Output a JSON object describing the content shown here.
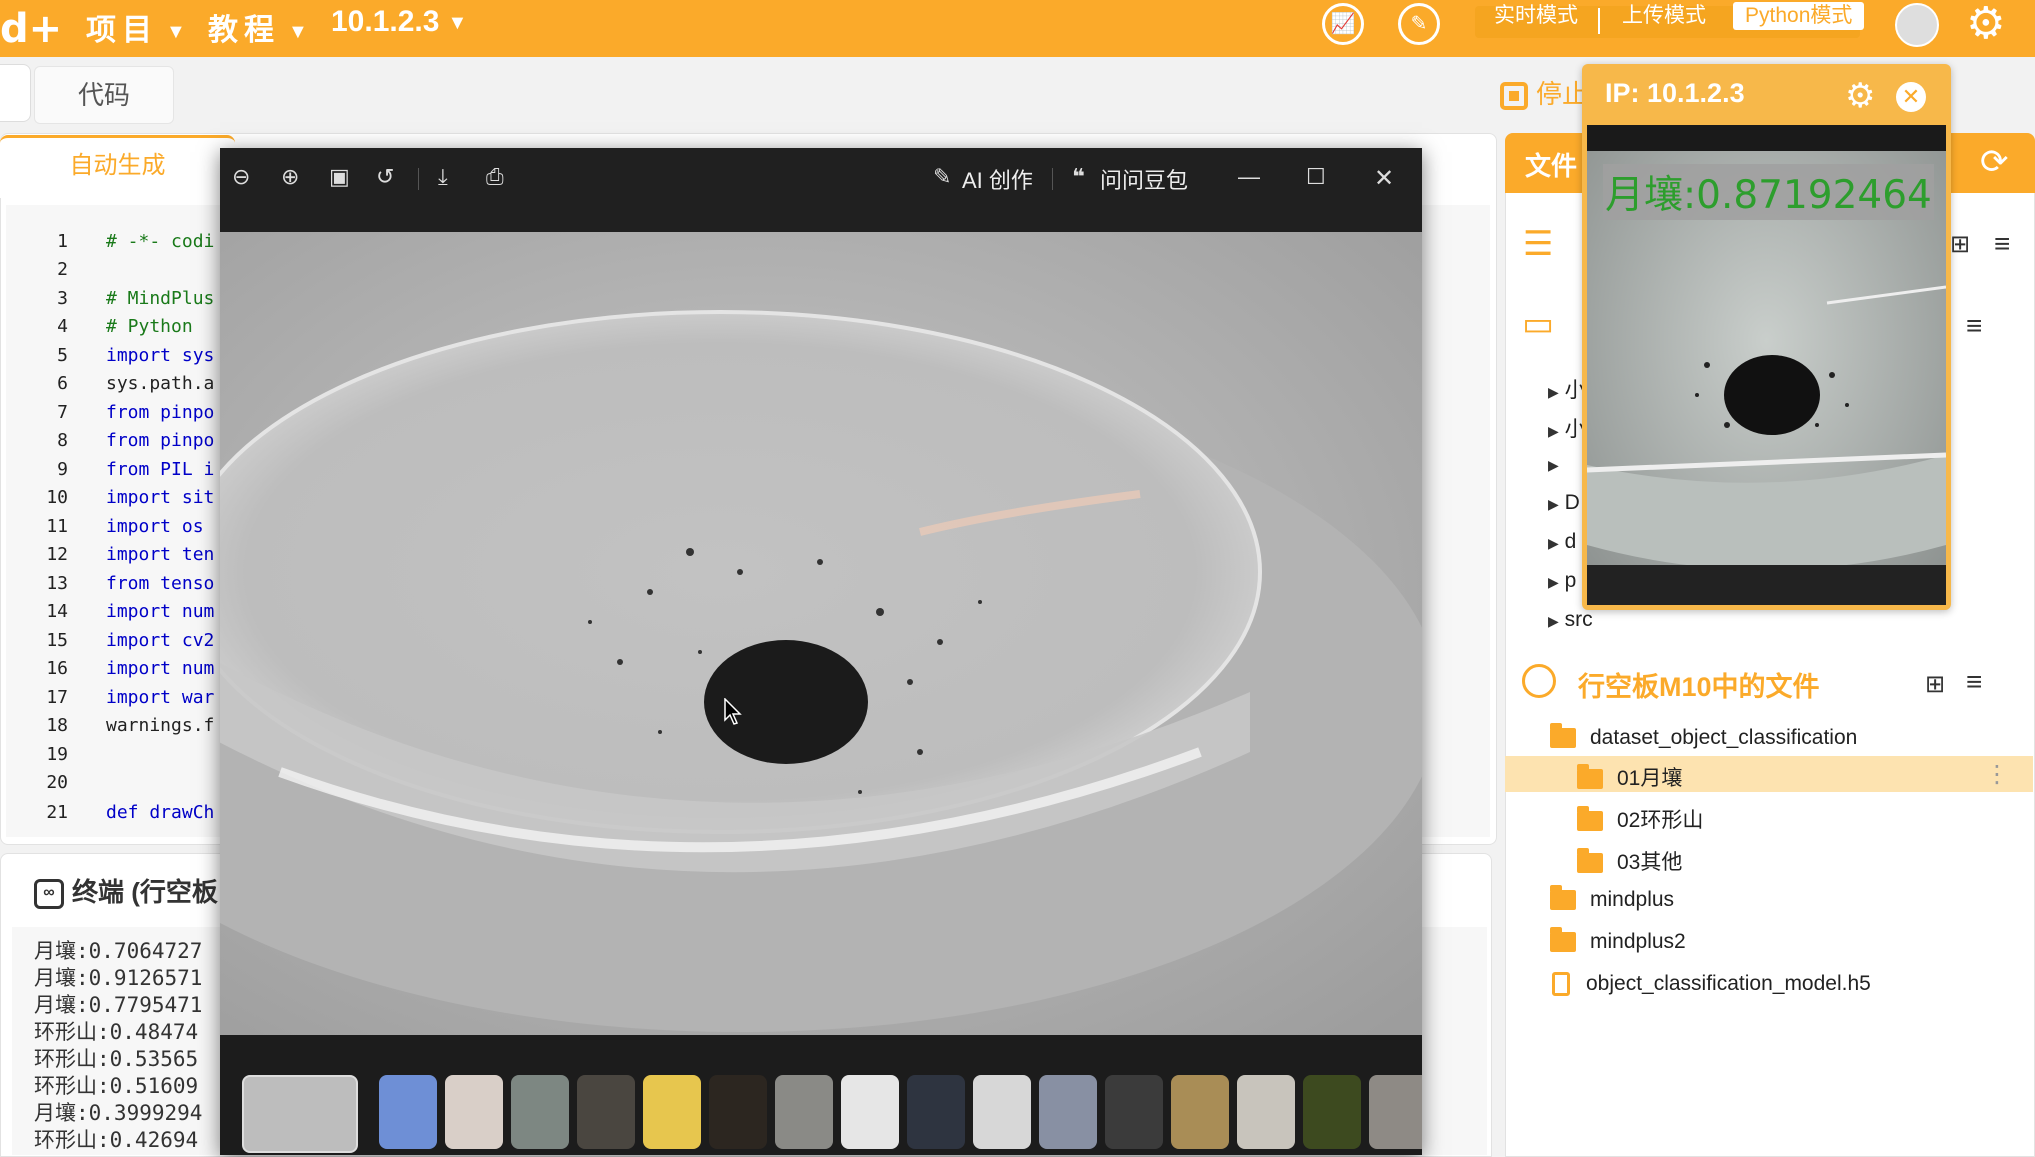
{
  "topbar": {
    "logo": "d+",
    "menu": [
      {
        "label": "项目"
      },
      {
        "label": "教程"
      },
      {
        "label": "10.1.2.3"
      }
    ],
    "modes": [
      "实时模式",
      "上传模式",
      "Python模式"
    ],
    "active_mode": "Python模式"
  },
  "toolbar": {
    "code_tab": "代码",
    "stop_label": "停止"
  },
  "editor": {
    "tab": "自动生成",
    "lines": [
      {
        "n": "1",
        "text": "# -*- codi"
      },
      {
        "n": "2",
        "text": ""
      },
      {
        "n": "3",
        "text": "# MindPlus"
      },
      {
        "n": "4",
        "text": "# Python"
      },
      {
        "n": "5",
        "text": "import sys"
      },
      {
        "n": "6",
        "text": "sys.path.a"
      },
      {
        "n": "7",
        "text": "from pinpo"
      },
      {
        "n": "8",
        "text": "from pinpo"
      },
      {
        "n": "9",
        "text": "from PIL i"
      },
      {
        "n": "10",
        "text": "import sit"
      },
      {
        "n": "11",
        "text": "import os"
      },
      {
        "n": "12",
        "text": "import ten"
      },
      {
        "n": "13",
        "text": "from tenso"
      },
      {
        "n": "14",
        "text": "import num"
      },
      {
        "n": "15",
        "text": "import cv2"
      },
      {
        "n": "16",
        "text": "import num"
      },
      {
        "n": "17",
        "text": "import war"
      },
      {
        "n": "18",
        "text": "warnings.f"
      },
      {
        "n": "19",
        "text": ""
      },
      {
        "n": "20",
        "text": ""
      },
      {
        "n": "21",
        "text": "def drawCh"
      }
    ]
  },
  "terminal": {
    "title": "终端 (行空板",
    "lines": [
      "月壤:0.7064727",
      "月壤:0.9126571",
      "月壤:0.7795471",
      "环形山:0.48474",
      "环形山:0.53565",
      "环形山:0.51609",
      "月壤:0.3999294",
      "环形山:0.42694"
    ]
  },
  "files": {
    "header": "文件",
    "m10_title": "行空板M10中的文件",
    "tree_partial": [
      "小",
      "小",
      "",
      "D",
      "d",
      "p",
      "src"
    ],
    "m10_items": [
      {
        "label": "dataset_object_classification",
        "type": "folder",
        "level": 0
      },
      {
        "label": "01月壤",
        "type": "folder",
        "level": 1,
        "selected": true
      },
      {
        "label": "02环形山",
        "type": "folder",
        "level": 1
      },
      {
        "label": "03其他",
        "type": "folder",
        "level": 1
      },
      {
        "label": "mindplus",
        "type": "folder",
        "level": 0
      },
      {
        "label": "mindplus2",
        "type": "folder",
        "level": 0
      },
      {
        "label": "object_classification_model.h5",
        "type": "file",
        "level": 0
      }
    ]
  },
  "camera_popup": {
    "title": "IP: 10.1.2.3",
    "overlay_label": "月壤:0.87192464"
  },
  "viewer": {
    "ai_create": "AI 创作",
    "ask_doubao": "问问豆包",
    "thumbnail_count": 17
  },
  "colors": {
    "brand": "#fbaa2a",
    "selected_row": "#fde3b0",
    "overlay_text": "#2d9e2d"
  }
}
